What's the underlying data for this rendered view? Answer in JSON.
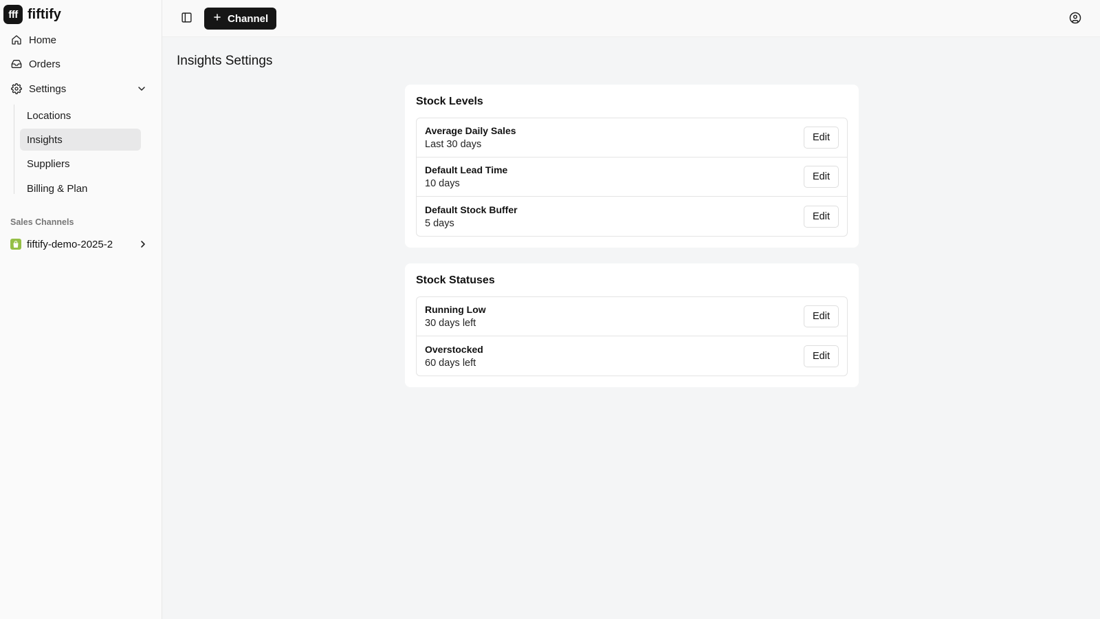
{
  "brand": {
    "logo_text": "fff",
    "name": "fiftify"
  },
  "sidebar": {
    "items": [
      {
        "label": "Home",
        "icon": "home-icon"
      },
      {
        "label": "Orders",
        "icon": "inbox-icon"
      },
      {
        "label": "Settings",
        "icon": "gear-icon"
      }
    ],
    "settings_sub": [
      {
        "label": "Locations"
      },
      {
        "label": "Insights"
      },
      {
        "label": "Suppliers"
      },
      {
        "label": "Billing & Plan"
      }
    ],
    "sales_channels_label": "Sales Channels",
    "channel": {
      "label": "fiftify-demo-2025-2",
      "icon": "shopify-bag-icon"
    }
  },
  "topbar": {
    "add_channel_label": "Channel"
  },
  "page": {
    "title": "Insights Settings"
  },
  "stock_levels": {
    "title": "Stock Levels",
    "rows": [
      {
        "label": "Average Daily Sales",
        "value": "Last 30 days"
      },
      {
        "label": "Default Lead Time",
        "value": "10 days"
      },
      {
        "label": "Default Stock Buffer",
        "value": "5 days"
      }
    ]
  },
  "stock_statuses": {
    "title": "Stock Statuses",
    "rows": [
      {
        "label": "Running Low",
        "value": "30 days left"
      },
      {
        "label": "Overstocked",
        "value": "60 days left"
      }
    ]
  },
  "edit_label": "Edit",
  "colors": {
    "primary_dark": "#161616",
    "shopify_green": "#95bf47",
    "active_bg": "#e8e8e9"
  }
}
